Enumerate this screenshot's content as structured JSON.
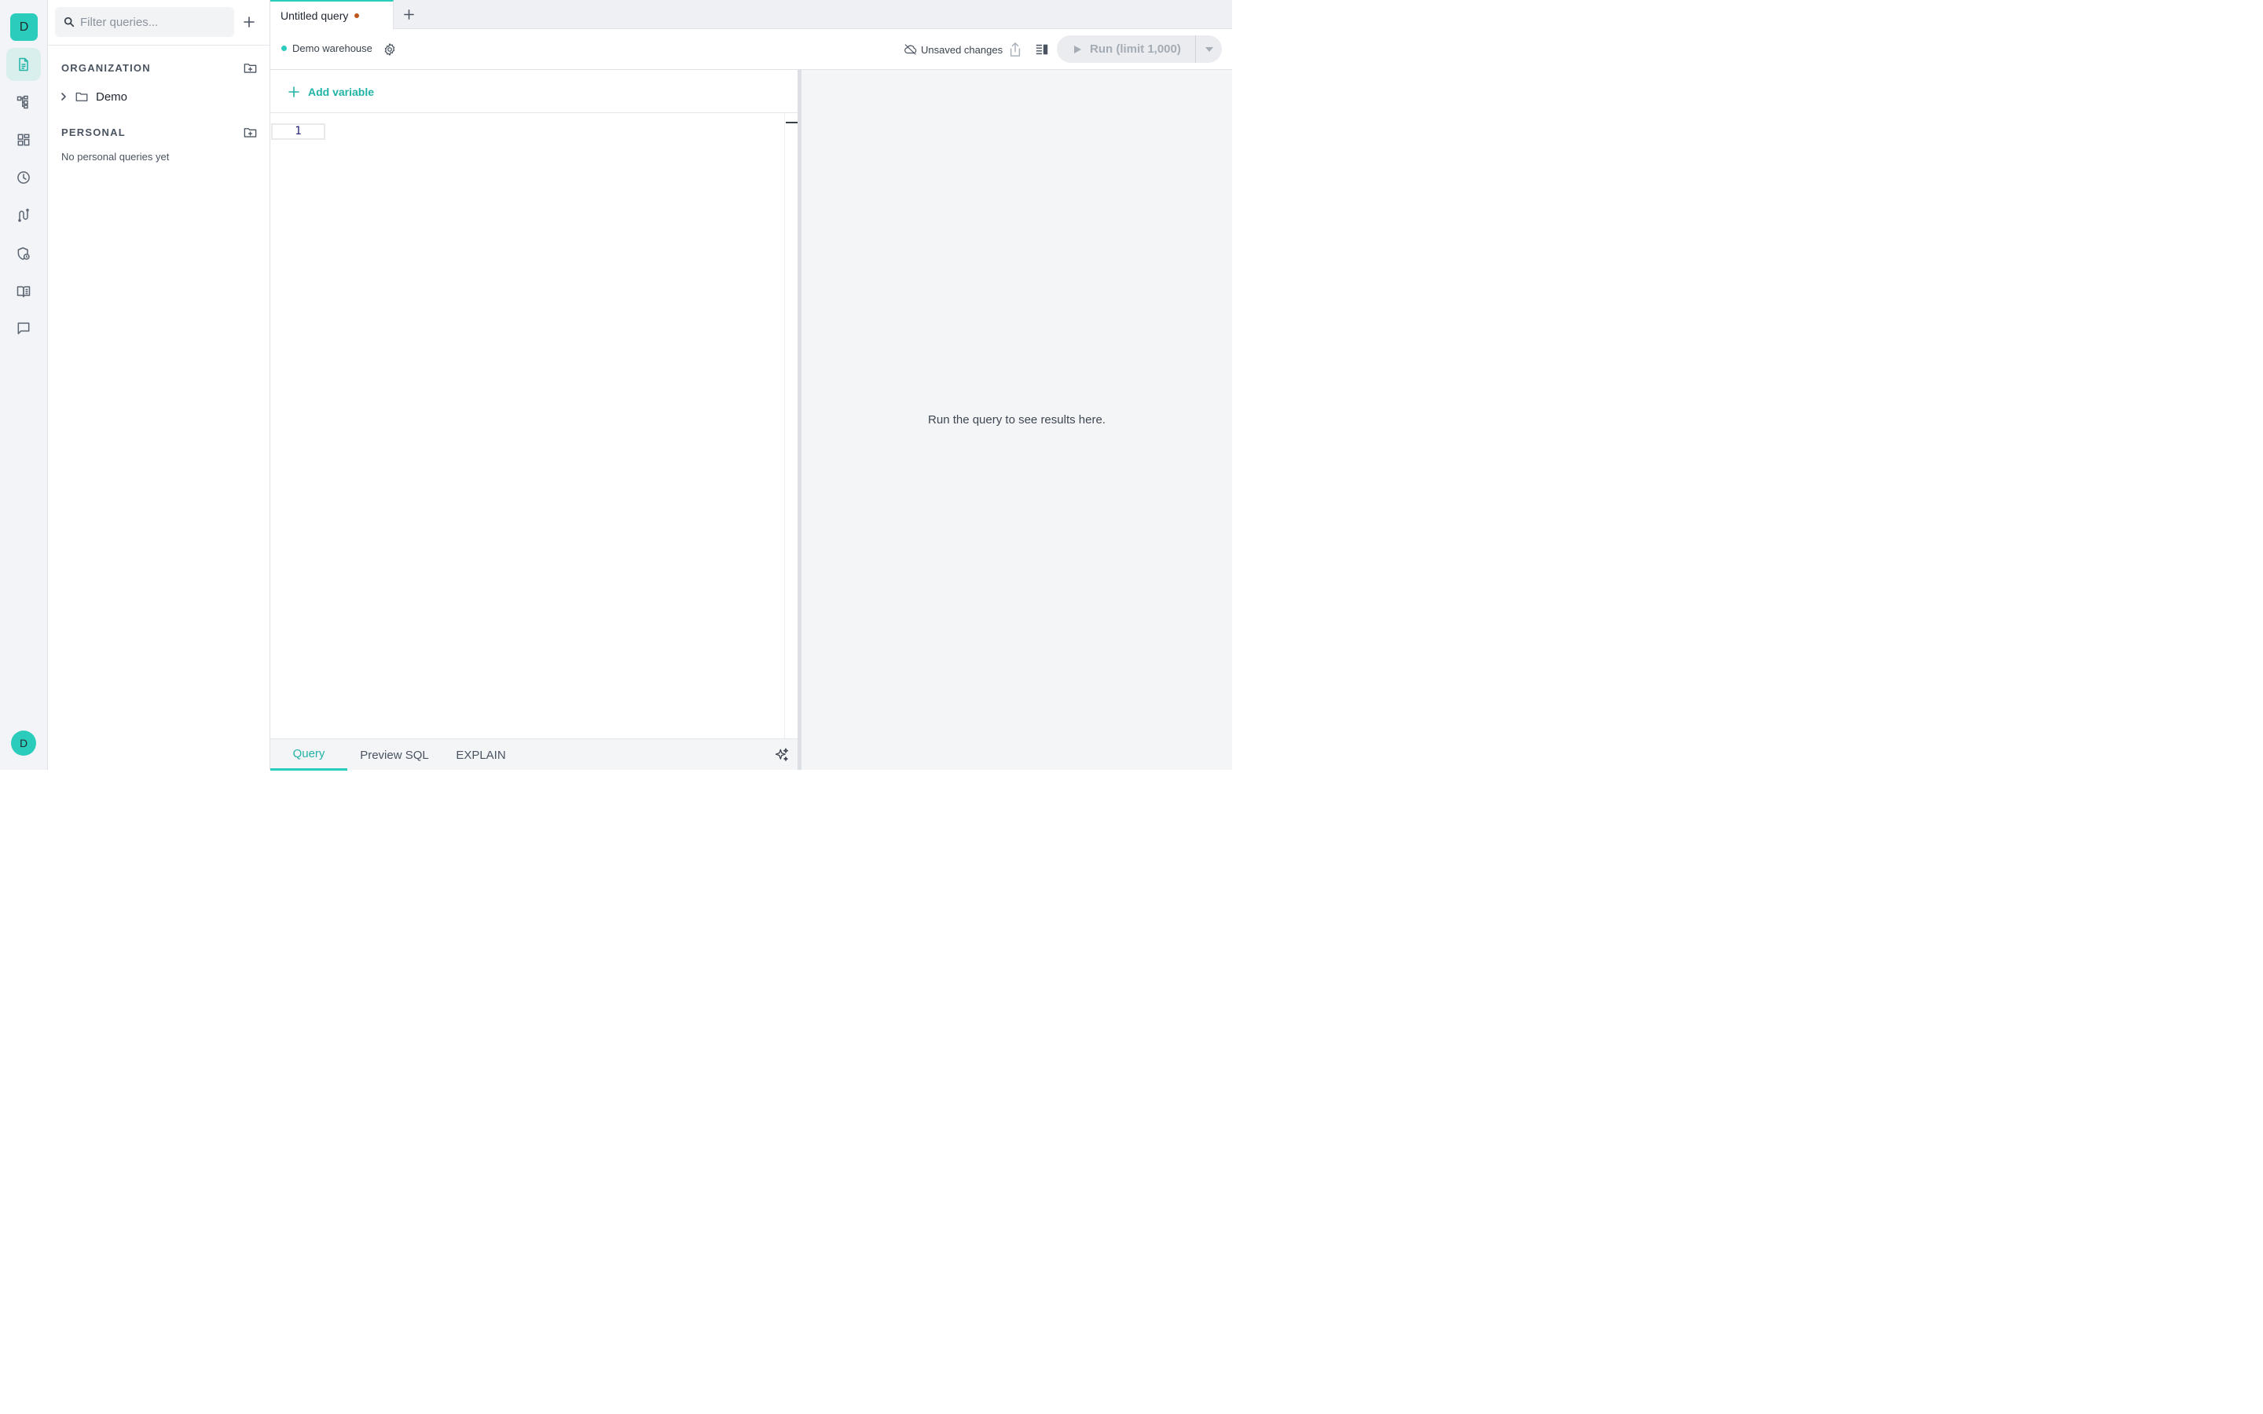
{
  "rail": {
    "workspace_initial": "D",
    "user_initial": "D",
    "items": [
      {
        "icon": "queries-icon",
        "active": true
      },
      {
        "icon": "schema-icon",
        "active": false
      },
      {
        "icon": "dashboards-icon",
        "active": false
      },
      {
        "icon": "history-icon",
        "active": false
      },
      {
        "icon": "pipelines-icon",
        "active": false
      },
      {
        "icon": "security-icon",
        "active": false
      },
      {
        "icon": "docs-icon",
        "active": false
      },
      {
        "icon": "chat-icon",
        "active": false
      }
    ]
  },
  "sidebar": {
    "filter_placeholder": "Filter queries...",
    "organization": {
      "title": "ORGANIZATION",
      "folders": [
        {
          "label": "Demo"
        }
      ]
    },
    "personal": {
      "title": "PERSONAL",
      "empty_text": "No personal queries yet"
    }
  },
  "tabs": [
    {
      "label": "Untitled query",
      "unsaved": true
    }
  ],
  "toolbar": {
    "connection_label": "Demo warehouse",
    "unsaved_label": "Unsaved changes",
    "run_label": "Run (limit 1,000)"
  },
  "editor": {
    "add_variable_label": "Add variable",
    "line_number": "1",
    "bottom_tabs": [
      {
        "label": "Query",
        "active": true
      },
      {
        "label": "Preview SQL",
        "active": false
      },
      {
        "label": "EXPLAIN",
        "active": false
      }
    ]
  },
  "results": {
    "empty_message": "Run the query to see results here."
  },
  "colors": {
    "accent": "#2cccbc",
    "accent_text": "#21b3a6",
    "unsaved_dot": "#c0561b",
    "rail_bg": "#f2f4f7",
    "results_bg": "#f4f5f7"
  }
}
